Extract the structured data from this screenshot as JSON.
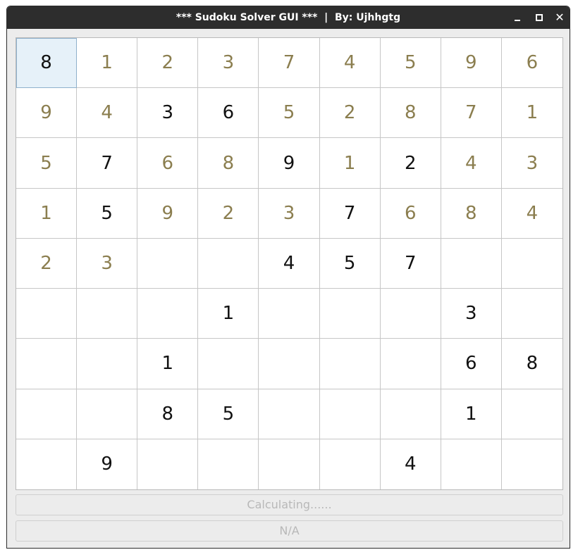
{
  "window": {
    "title": "*** Sudoku Solver GUI ***  |  By: Ujhhgtg",
    "close_glyph": "✕"
  },
  "board": {
    "selected": [
      0,
      0
    ],
    "rows": [
      [
        {
          "v": "8",
          "k": "given"
        },
        {
          "v": "1",
          "k": "solved"
        },
        {
          "v": "2",
          "k": "solved"
        },
        {
          "v": "3",
          "k": "solved"
        },
        {
          "v": "7",
          "k": "solved"
        },
        {
          "v": "4",
          "k": "solved"
        },
        {
          "v": "5",
          "k": "solved"
        },
        {
          "v": "9",
          "k": "solved"
        },
        {
          "v": "6",
          "k": "solved"
        }
      ],
      [
        {
          "v": "9",
          "k": "solved"
        },
        {
          "v": "4",
          "k": "solved"
        },
        {
          "v": "3",
          "k": "given"
        },
        {
          "v": "6",
          "k": "given"
        },
        {
          "v": "5",
          "k": "solved"
        },
        {
          "v": "2",
          "k": "solved"
        },
        {
          "v": "8",
          "k": "solved"
        },
        {
          "v": "7",
          "k": "solved"
        },
        {
          "v": "1",
          "k": "solved"
        }
      ],
      [
        {
          "v": "5",
          "k": "solved"
        },
        {
          "v": "7",
          "k": "given"
        },
        {
          "v": "6",
          "k": "solved"
        },
        {
          "v": "8",
          "k": "solved"
        },
        {
          "v": "9",
          "k": "given"
        },
        {
          "v": "1",
          "k": "solved"
        },
        {
          "v": "2",
          "k": "given"
        },
        {
          "v": "4",
          "k": "solved"
        },
        {
          "v": "3",
          "k": "solved"
        }
      ],
      [
        {
          "v": "1",
          "k": "solved"
        },
        {
          "v": "5",
          "k": "given"
        },
        {
          "v": "9",
          "k": "solved"
        },
        {
          "v": "2",
          "k": "solved"
        },
        {
          "v": "3",
          "k": "solved"
        },
        {
          "v": "7",
          "k": "given"
        },
        {
          "v": "6",
          "k": "solved"
        },
        {
          "v": "8",
          "k": "solved"
        },
        {
          "v": "4",
          "k": "solved"
        }
      ],
      [
        {
          "v": "2",
          "k": "solved"
        },
        {
          "v": "3",
          "k": "solved"
        },
        {
          "v": "",
          "k": "empty"
        },
        {
          "v": "",
          "k": "empty"
        },
        {
          "v": "4",
          "k": "given"
        },
        {
          "v": "5",
          "k": "given"
        },
        {
          "v": "7",
          "k": "given"
        },
        {
          "v": "",
          "k": "empty"
        },
        {
          "v": "",
          "k": "empty"
        }
      ],
      [
        {
          "v": "",
          "k": "empty"
        },
        {
          "v": "",
          "k": "empty"
        },
        {
          "v": "",
          "k": "empty"
        },
        {
          "v": "1",
          "k": "given"
        },
        {
          "v": "",
          "k": "empty"
        },
        {
          "v": "",
          "k": "empty"
        },
        {
          "v": "",
          "k": "empty"
        },
        {
          "v": "3",
          "k": "given"
        },
        {
          "v": "",
          "k": "empty"
        }
      ],
      [
        {
          "v": "",
          "k": "empty"
        },
        {
          "v": "",
          "k": "empty"
        },
        {
          "v": "1",
          "k": "given"
        },
        {
          "v": "",
          "k": "empty"
        },
        {
          "v": "",
          "k": "empty"
        },
        {
          "v": "",
          "k": "empty"
        },
        {
          "v": "",
          "k": "empty"
        },
        {
          "v": "6",
          "k": "given"
        },
        {
          "v": "8",
          "k": "given"
        }
      ],
      [
        {
          "v": "",
          "k": "empty"
        },
        {
          "v": "",
          "k": "empty"
        },
        {
          "v": "8",
          "k": "given"
        },
        {
          "v": "5",
          "k": "given"
        },
        {
          "v": "",
          "k": "empty"
        },
        {
          "v": "",
          "k": "empty"
        },
        {
          "v": "",
          "k": "empty"
        },
        {
          "v": "1",
          "k": "given"
        },
        {
          "v": "",
          "k": "empty"
        }
      ],
      [
        {
          "v": "",
          "k": "empty"
        },
        {
          "v": "9",
          "k": "given"
        },
        {
          "v": "",
          "k": "empty"
        },
        {
          "v": "",
          "k": "empty"
        },
        {
          "v": "",
          "k": "empty"
        },
        {
          "v": "",
          "k": "empty"
        },
        {
          "v": "4",
          "k": "given"
        },
        {
          "v": "",
          "k": "empty"
        },
        {
          "v": "",
          "k": "empty"
        }
      ]
    ]
  },
  "status": {
    "primary": "Calculating......",
    "secondary": "N/A"
  },
  "colors": {
    "solved_digit": "#8b7e4f",
    "given_digit": "#111111",
    "selected_bg": "#e6f1f9",
    "titlebar": "#2d2d2d"
  }
}
